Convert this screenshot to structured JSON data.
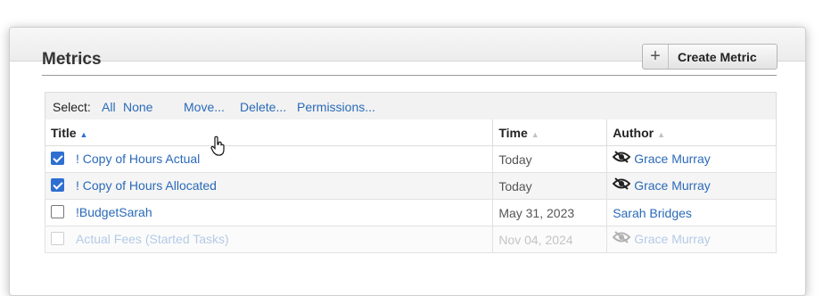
{
  "page": {
    "title": "Metrics"
  },
  "toolbar": {
    "create_label": "Create Metric"
  },
  "select_bar": {
    "select_label": "Select:",
    "all": "All",
    "none": "None",
    "move": "Move...",
    "delete": "Delete...",
    "permissions": "Permissions..."
  },
  "table": {
    "headers": {
      "title": "Title",
      "time": "Time",
      "author": "Author"
    },
    "rows": [
      {
        "checked": true,
        "title": "! Copy of Hours Actual",
        "time": "Today",
        "author": "Grace Murray",
        "hidden_icon": true
      },
      {
        "checked": true,
        "title": "! Copy of Hours Allocated",
        "time": "Today",
        "author": "Grace Murray",
        "hidden_icon": true
      },
      {
        "checked": false,
        "title": "!BudgetSarah",
        "time": "May 31, 2023",
        "author": "Sarah Bridges",
        "hidden_icon": false
      },
      {
        "checked": false,
        "title": "Actual Fees (Started Tasks)",
        "time": "Nov 04, 2024",
        "author": "Grace Murray",
        "hidden_icon": true
      }
    ]
  },
  "colors": {
    "link": "#2a6ab8",
    "checkbox": "#2f6fd0"
  },
  "icons": {
    "plus": "plus-icon",
    "sort": "sort-asc-icon",
    "hidden": "eye-slash-icon",
    "cursor": "hand-pointer-icon"
  }
}
